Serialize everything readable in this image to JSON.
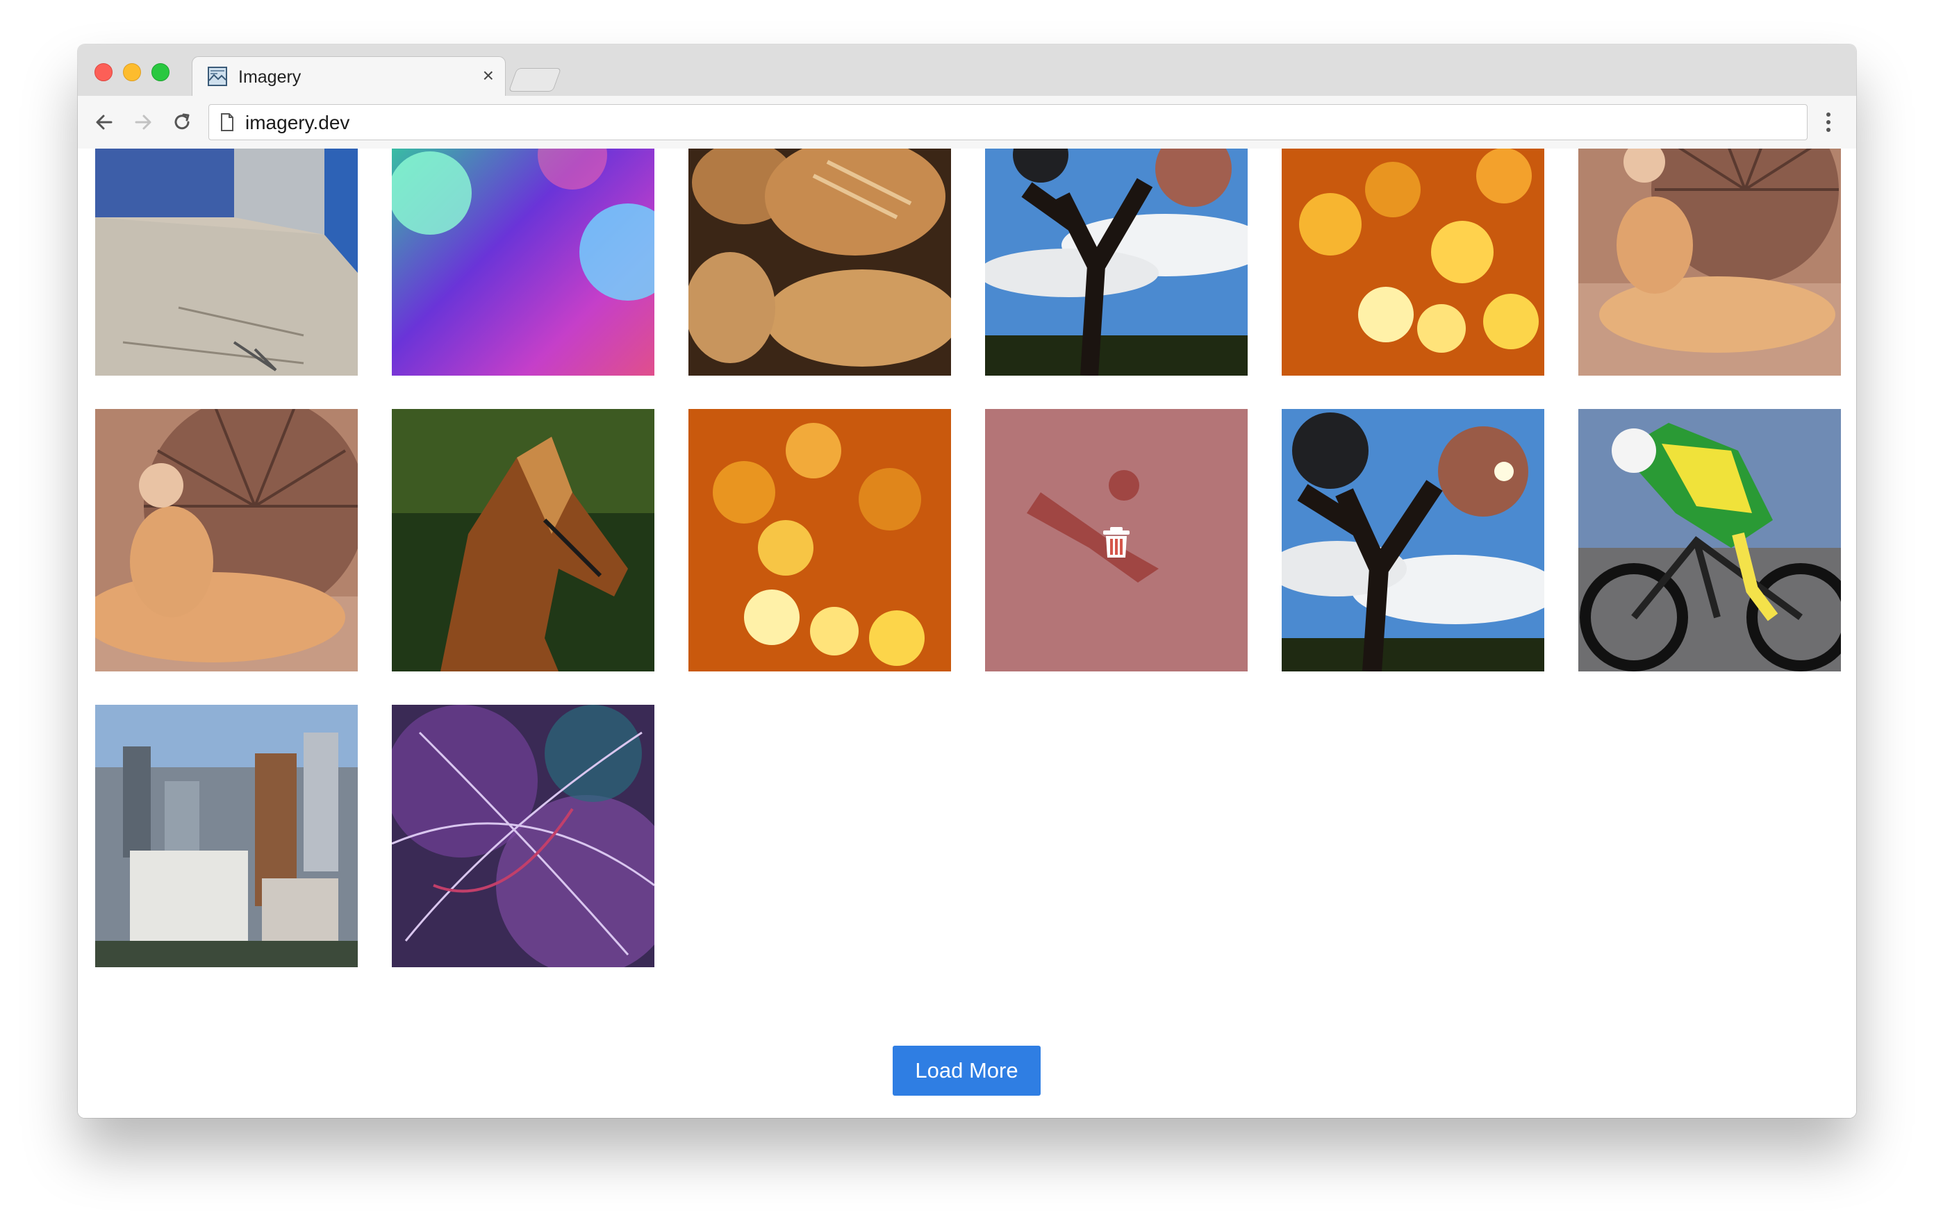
{
  "browser": {
    "tab_title": "Imagery",
    "tab_close": "×",
    "url": "imagery.dev",
    "icons": {
      "back": "arrow-left-icon",
      "forward": "arrow-right-icon",
      "reload": "reload-icon",
      "menu": "kebab-menu-icon",
      "page": "page-icon",
      "favicon": "imagery-favicon"
    }
  },
  "gallery": {
    "images": [
      {
        "subject": "street sidewalk with blue wall",
        "row": 1,
        "col": 1
      },
      {
        "subject": "colorful bokeh lights",
        "row": 1,
        "col": 2
      },
      {
        "subject": "bread loaves",
        "row": 1,
        "col": 3
      },
      {
        "subject": "tree silhouette against clouds",
        "row": 1,
        "col": 4
      },
      {
        "subject": "golden bokeh lights",
        "row": 1,
        "col": 5
      },
      {
        "subject": "reclining woman painting",
        "row": 1,
        "col": 6
      },
      {
        "subject": "reclining woman painting",
        "row": 2,
        "col": 1
      },
      {
        "subject": "horse portrait",
        "row": 2,
        "col": 2
      },
      {
        "subject": "golden bokeh lights",
        "row": 2,
        "col": 3
      },
      {
        "subject": "swimmer underwater",
        "row": 2,
        "col": 4,
        "hovered": true
      },
      {
        "subject": "tree silhouette against clouds",
        "row": 2,
        "col": 5
      },
      {
        "subject": "cyclist time trial",
        "row": 2,
        "col": 6
      },
      {
        "subject": "city skyline",
        "row": 3,
        "col": 1
      },
      {
        "subject": "abstract purple fractal",
        "row": 3,
        "col": 2
      }
    ],
    "hover_action_icon": "trash-icon"
  },
  "load_more_label": "Load More",
  "colors": {
    "accent": "#2f7ee3",
    "hover_overlay": "#e85046"
  }
}
